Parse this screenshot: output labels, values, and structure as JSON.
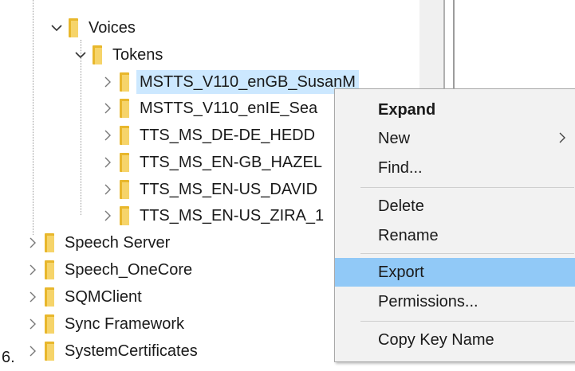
{
  "tree": {
    "voices": "Voices",
    "tokens": "Tokens",
    "token_items": [
      "MSTTS_V110_enGB_SusanM",
      "MSTTS_V110_enIE_Sea",
      "TTS_MS_DE-DE_HEDD",
      "TTS_MS_EN-GB_HAZEL",
      "TTS_MS_EN-US_DAVID",
      "TTS_MS_EN-US_ZIRA_1"
    ],
    "root_items": [
      "Speech Server",
      "Speech_OneCore",
      "SQMClient",
      "Sync Framework",
      "SystemCertificates"
    ]
  },
  "context_menu": {
    "expand": "Expand",
    "new": "New",
    "find": "Find...",
    "delete": "Delete",
    "rename": "Rename",
    "export": "Export",
    "permissions": "Permissions...",
    "copy_key_name": "Copy Key Name"
  },
  "step_number": "6.",
  "colors": {
    "selection": "#cce8ff",
    "menu_hover": "#91c9f7",
    "menu_bg": "#f2f2f2",
    "folder": "#f6d46a"
  }
}
